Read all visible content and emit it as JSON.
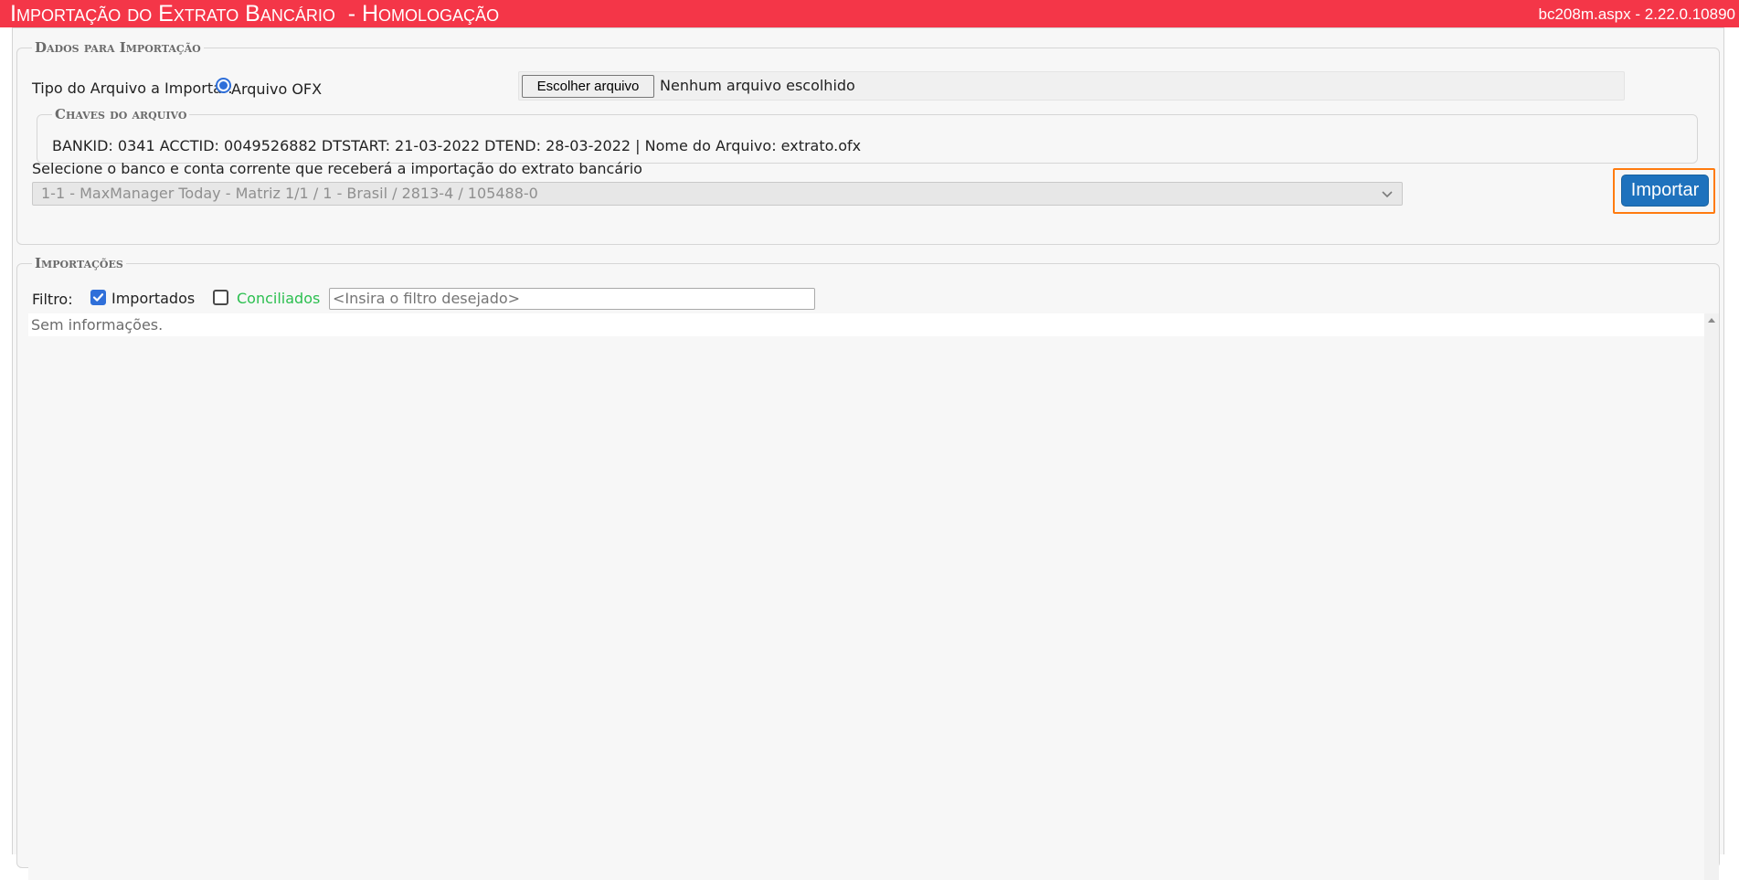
{
  "header": {
    "title": "Importação do Extrato Bancário  - Homologação",
    "version": "bc208m.aspx - 2.22.0.10890"
  },
  "import_section": {
    "legend": "Dados para Importação",
    "file_type_label": "Tipo do Arquivo a Importar:",
    "radio_option_label": "Arquivo OFX",
    "radio_selected": true,
    "file_button_label": "Escolher arquivo",
    "file_status": "Nenhum arquivo escolhido",
    "keys_legend": "Chaves do arquivo",
    "keys_text": "BANKID: 0341 ACCTID: 0049526882 DTSTART: 21-03-2022 DTEND: 28-03-2022 | Nome do Arquivo: extrato.ofx",
    "account_select_label": "Selecione o banco e conta corrente que receberá a importação do extrato bancário",
    "account_select_value": "1-1 - MaxManager Today - Matriz 1/1 / 1 - Brasil / 2813-4 / 105488-0",
    "import_button_label": "Importar"
  },
  "imports_section": {
    "legend": "Importações",
    "filter_label": "Filtro:",
    "filters": [
      {
        "label": "Importados",
        "checked": true,
        "color": "#222222"
      },
      {
        "label": "Conciliados",
        "checked": false,
        "color": "#2bbf4f"
      }
    ],
    "filter_placeholder": "<Insira o filtro desejado>",
    "empty_message": "Sem informações."
  },
  "colors": {
    "titlebar": "#f43648",
    "accent_button": "#1e72bd",
    "focus_outline": "#ff7b0f",
    "checkbox_blue": "#2f6fd9"
  }
}
